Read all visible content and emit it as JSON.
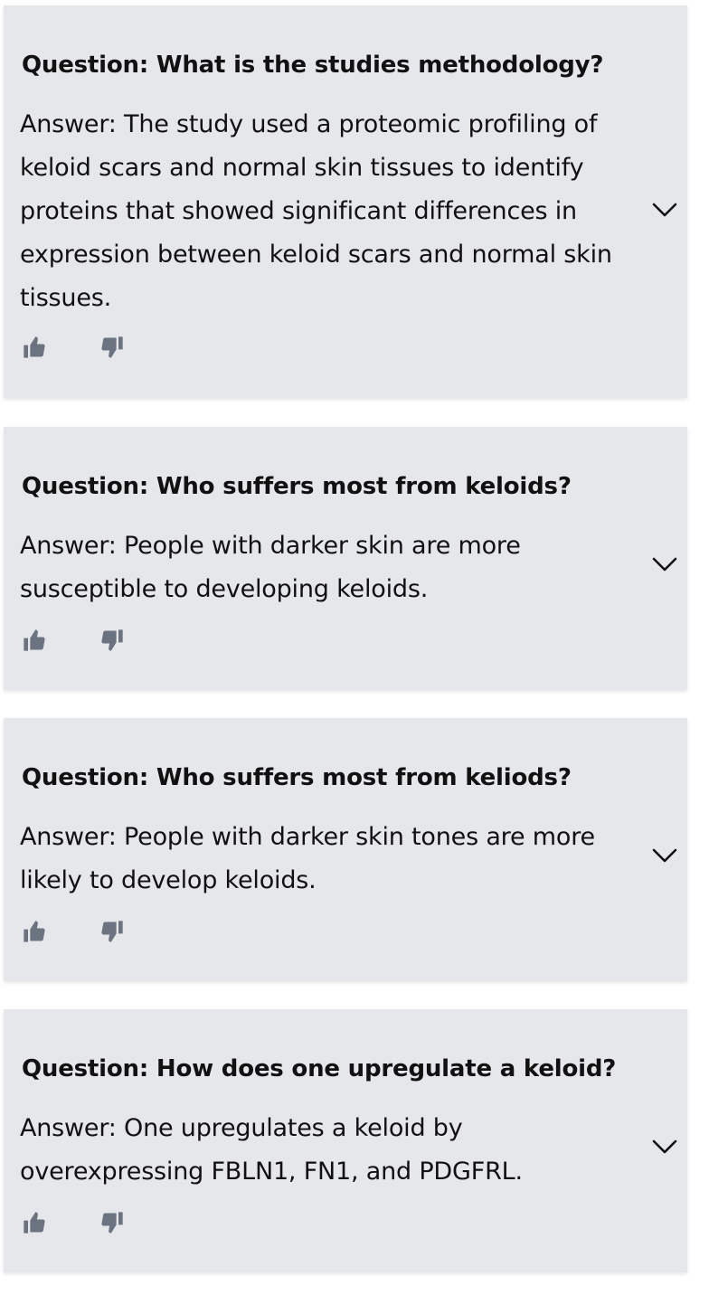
{
  "qa_items": [
    {
      "question": "Question: What is the studies methodology?",
      "answer": "Answer: The study used a proteomic profiling of keloid scars and normal skin tissues to identify proteins that showed significant differences in expression between keloid scars and normal skin tissues."
    },
    {
      "question": "Question: Who suffers most from keloids?",
      "answer": "Answer: People with darker skin are more susceptible to developing keloids."
    },
    {
      "question": "Question: Who suffers most from keliods?",
      "answer": "Answer: People with darker skin tones are more likely to develop keloids."
    },
    {
      "question": "Question: How does one upregulate a keloid?",
      "answer": "Answer: One upregulates a keloid by overexpressing FBLN1, FN1, and PDGFRL."
    }
  ],
  "icons": {
    "upvote": "thumbs-up-icon",
    "downvote": "thumbs-down-icon",
    "expand": "chevron-down-icon"
  },
  "colors": {
    "card_background": "#e6e7ea",
    "icon": "#6b7280",
    "text": "#111111"
  }
}
